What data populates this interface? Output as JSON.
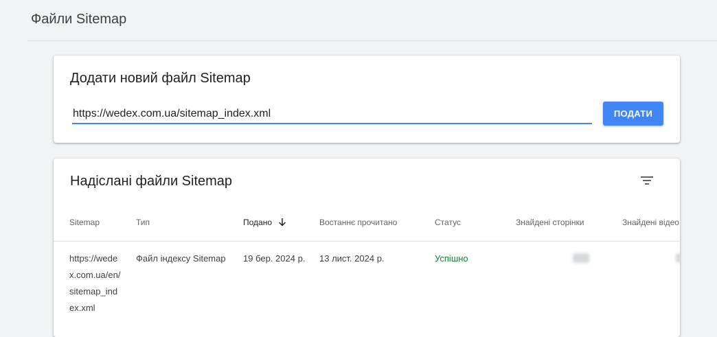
{
  "page": {
    "title": "Файли Sitemap"
  },
  "add_card": {
    "title": "Додати новий файл Sitemap",
    "input_value": "https://wedex.com.ua/sitemap_index.xml",
    "submit_label": "ПОДАТИ"
  },
  "list_card": {
    "title": "Надіслані файли Sitemap",
    "filter_icon": "filter-icon",
    "columns": {
      "sitemap": "Sitemap",
      "type": "Тип",
      "submitted": "Подано",
      "last_read": "Востаннє прочитано",
      "status": "Статус",
      "found_pages": "Знайдені сторінки",
      "found_videos": "Знайдені відео"
    },
    "rows": [
      {
        "sitemap": "https://wedex.com.ua/en/sitemap_index.xml",
        "type": "Файл індексу Sitemap",
        "submitted": "19 бер. 2024 р.",
        "last_read": "13 лист. 2024 р.",
        "status": "Успішно",
        "status_color": "#188038"
      }
    ]
  },
  "colors": {
    "accent": "#4285f4",
    "success": "#188038",
    "background": "#f1f3f4"
  }
}
